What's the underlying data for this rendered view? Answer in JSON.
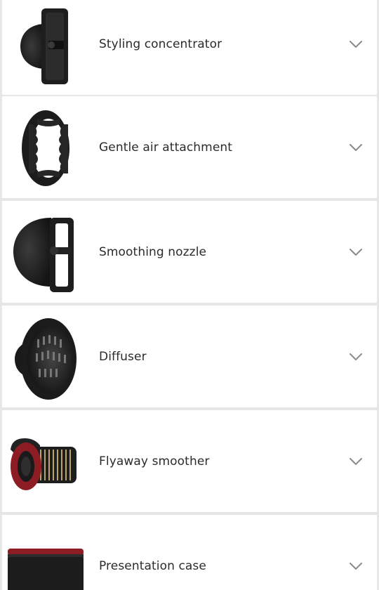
{
  "attachments": [
    {
      "label": "Styling concentrator",
      "icon": "styling-concentrator-icon"
    },
    {
      "label": "Gentle air attachment",
      "icon": "gentle-air-attachment-icon"
    },
    {
      "label": "Smoothing nozzle",
      "icon": "smoothing-nozzle-icon"
    },
    {
      "label": "Diffuser",
      "icon": "diffuser-icon"
    },
    {
      "label": "Flyaway smoother",
      "icon": "flyaway-smoother-icon"
    },
    {
      "label": "Presentation case",
      "icon": "presentation-case-icon"
    }
  ],
  "colors": {
    "accent_red": "#8d1c24",
    "product_black": "#1c1c1c",
    "chevron": "#8a8a8a",
    "divider": "#e6e6e6"
  }
}
